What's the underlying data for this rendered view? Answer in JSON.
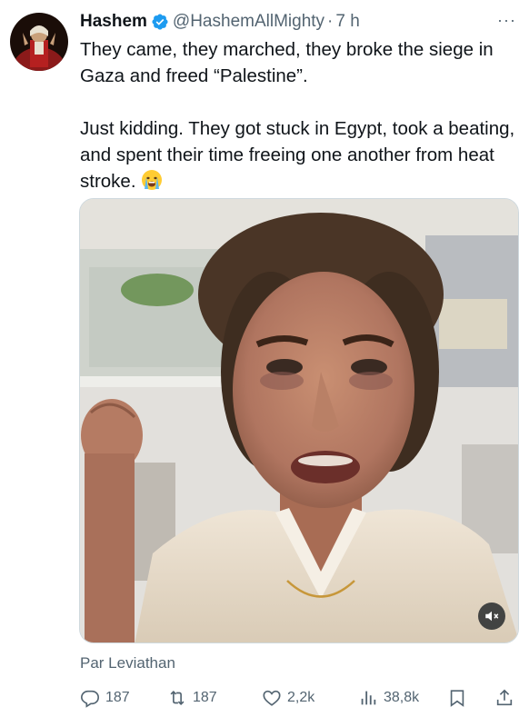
{
  "author": {
    "name": "Hashem",
    "handle": "@HashemAllMighty",
    "separator": "·",
    "time": "7 h",
    "verified": true
  },
  "tweet": {
    "line1": "They came, they marched, they broke the siege in Gaza and freed “Palestine”.",
    "line2": "Just kidding. They got stuck in Egypt, took a beating, and spent their time freeing one another from heat stroke.",
    "emoji": "crying-face-emoji"
  },
  "media": {
    "type": "video",
    "muted": true
  },
  "credit": "Par Leviathan",
  "actions": {
    "replies": "187",
    "reposts": "187",
    "likes": "2,2k",
    "views": "38,8k"
  },
  "colors": {
    "text": "#0f1419",
    "secondary": "#536471",
    "verified": "#1d9bf0",
    "border": "#cfd9de"
  },
  "icons": [
    "verified-badge-icon",
    "more-icon",
    "mute-icon",
    "reply-icon",
    "repost-icon",
    "like-icon",
    "views-icon",
    "bookmark-icon",
    "share-icon"
  ]
}
